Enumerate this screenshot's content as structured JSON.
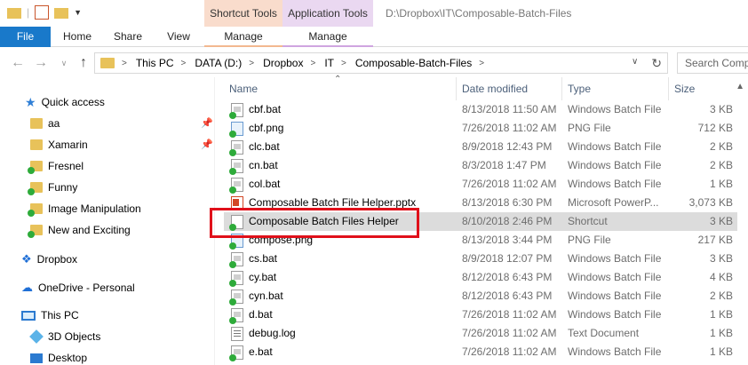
{
  "window": {
    "path_title": "D:\\Dropbox\\IT\\Composable-Batch-Files",
    "context_tabs": {
      "shortcut_tools": "Shortcut Tools",
      "application_tools": "Application Tools"
    }
  },
  "ribbon": {
    "tabs": [
      "File",
      "Home",
      "Share",
      "View",
      "Manage",
      "Manage"
    ]
  },
  "address": {
    "crumbs": [
      "This PC",
      "DATA (D:)",
      "Dropbox",
      "IT",
      "Composable-Batch-Files"
    ],
    "search_placeholder": "Search Comp"
  },
  "sidebar": {
    "quick_access": "Quick access",
    "items": [
      {
        "label": "aa",
        "pinned": true,
        "synced": false
      },
      {
        "label": "Xamarin",
        "pinned": true,
        "synced": false
      },
      {
        "label": "Fresnel",
        "pinned": false,
        "synced": true
      },
      {
        "label": "Funny",
        "pinned": false,
        "synced": true
      },
      {
        "label": "Image Manipulation",
        "pinned": false,
        "synced": true
      },
      {
        "label": "New and Exciting",
        "pinned": false,
        "synced": true
      }
    ],
    "dropbox": "Dropbox",
    "onedrive": "OneDrive - Personal",
    "this_pc": "This PC",
    "objects_3d": "3D Objects",
    "desktop": "Desktop"
  },
  "columns": {
    "name": "Name",
    "date": "Date modified",
    "type": "Type",
    "size": "Size"
  },
  "files": [
    {
      "name": "cbf.bat",
      "date": "8/13/2018 11:50 AM",
      "type": "Windows Batch File",
      "size": "3 KB",
      "icon": "bat"
    },
    {
      "name": "cbf.png",
      "date": "7/26/2018 11:02 AM",
      "type": "PNG File",
      "size": "712 KB",
      "icon": "png"
    },
    {
      "name": "clc.bat",
      "date": "8/9/2018 12:43 PM",
      "type": "Windows Batch File",
      "size": "2 KB",
      "icon": "bat"
    },
    {
      "name": "cn.bat",
      "date": "8/3/2018 1:47 PM",
      "type": "Windows Batch File",
      "size": "2 KB",
      "icon": "bat"
    },
    {
      "name": "col.bat",
      "date": "7/26/2018 11:02 AM",
      "type": "Windows Batch File",
      "size": "1 KB",
      "icon": "bat"
    },
    {
      "name": "Composable Batch File Helper.pptx",
      "date": "8/13/2018 6:30 PM",
      "type": "Microsoft PowerP...",
      "size": "3,073 KB",
      "icon": "pptx"
    },
    {
      "name": "Composable Batch Files Helper",
      "date": "8/10/2018 2:46 PM",
      "type": "Shortcut",
      "size": "3 KB",
      "icon": "lnk",
      "selected": true
    },
    {
      "name": "compose.png",
      "date": "8/13/2018 3:44 PM",
      "type": "PNG File",
      "size": "217 KB",
      "icon": "png"
    },
    {
      "name": "cs.bat",
      "date": "8/9/2018 12:07 PM",
      "type": "Windows Batch File",
      "size": "3 KB",
      "icon": "bat"
    },
    {
      "name": "cy.bat",
      "date": "8/12/2018 6:43 PM",
      "type": "Windows Batch File",
      "size": "4 KB",
      "icon": "bat"
    },
    {
      "name": "cyn.bat",
      "date": "8/12/2018 6:43 PM",
      "type": "Windows Batch File",
      "size": "2 KB",
      "icon": "bat"
    },
    {
      "name": "d.bat",
      "date": "7/26/2018 11:02 AM",
      "type": "Windows Batch File",
      "size": "1 KB",
      "icon": "bat"
    },
    {
      "name": "debug.log",
      "date": "7/26/2018 11:02 AM",
      "type": "Text Document",
      "size": "1 KB",
      "icon": "log"
    },
    {
      "name": "e.bat",
      "date": "7/26/2018 11:02 AM",
      "type": "Windows Batch File",
      "size": "1 KB",
      "icon": "bat"
    }
  ]
}
